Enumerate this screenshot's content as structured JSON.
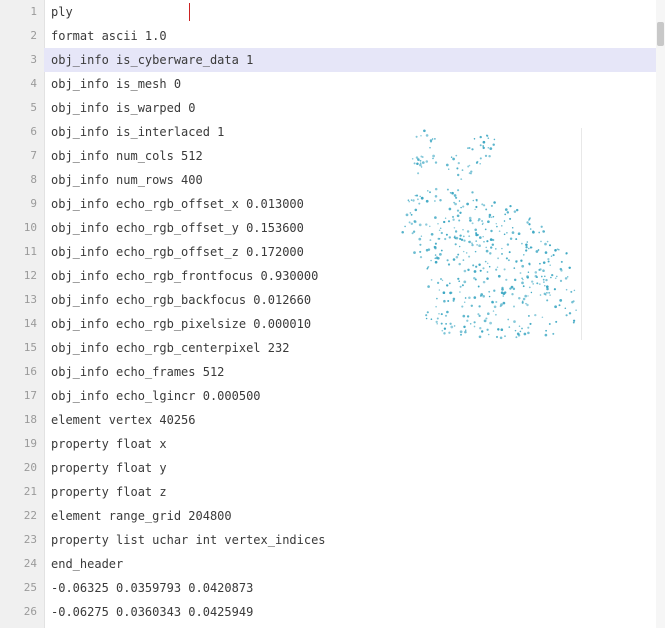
{
  "editor": {
    "active_line": 3,
    "lines": [
      {
        "num": "1",
        "text": "ply"
      },
      {
        "num": "2",
        "text": "format ascii 1.0"
      },
      {
        "num": "3",
        "text": "obj_info is_cyberware_data 1"
      },
      {
        "num": "4",
        "text": "obj_info is_mesh 0"
      },
      {
        "num": "5",
        "text": "obj_info is_warped 0"
      },
      {
        "num": "6",
        "text": "obj_info is_interlaced 1"
      },
      {
        "num": "7",
        "text": "obj_info num_cols 512"
      },
      {
        "num": "8",
        "text": "obj_info num_rows 400"
      },
      {
        "num": "9",
        "text": "obj_info echo_rgb_offset_x 0.013000"
      },
      {
        "num": "10",
        "text": "obj_info echo_rgb_offset_y 0.153600"
      },
      {
        "num": "11",
        "text": "obj_info echo_rgb_offset_z 0.172000"
      },
      {
        "num": "12",
        "text": "obj_info echo_rgb_frontfocus 0.930000"
      },
      {
        "num": "13",
        "text": "obj_info echo_rgb_backfocus 0.012660"
      },
      {
        "num": "14",
        "text": "obj_info echo_rgb_pixelsize 0.000010"
      },
      {
        "num": "15",
        "text": "obj_info echo_rgb_centerpixel 232"
      },
      {
        "num": "16",
        "text": "obj_info echo_frames 512"
      },
      {
        "num": "17",
        "text": "obj_info echo_lgincr 0.000500"
      },
      {
        "num": "18",
        "text": "element vertex 40256"
      },
      {
        "num": "19",
        "text": "property float x"
      },
      {
        "num": "20",
        "text": "property float y"
      },
      {
        "num": "21",
        "text": "property float z"
      },
      {
        "num": "22",
        "text": "element range_grid 204800"
      },
      {
        "num": "23",
        "text": "property list uchar int vertex_indices"
      },
      {
        "num": "24",
        "text": "end_header"
      },
      {
        "num": "25",
        "text": "-0.06325 0.0359793 0.0420873"
      },
      {
        "num": "26",
        "text": "-0.06275 0.0360343 0.0425949"
      }
    ]
  },
  "figure": {
    "subject": "bunny point cloud",
    "point_color": "#3aa6c2"
  },
  "colors": {
    "gutter_bg": "#f0f0f0",
    "line_number": "#9a9a9a",
    "code_text": "#3a3a3a",
    "active_line_bg": "#e6e6f8",
    "caret": "#cc2222"
  }
}
